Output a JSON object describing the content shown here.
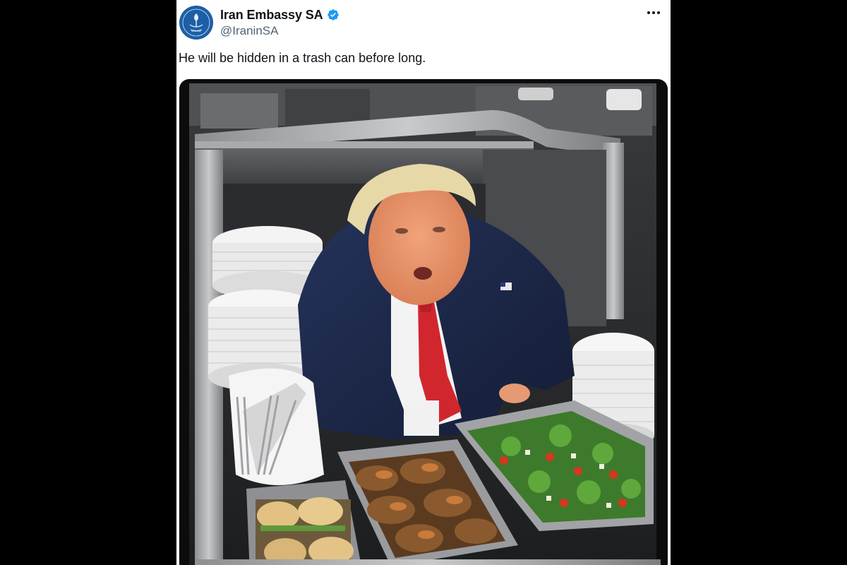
{
  "tweet": {
    "author": {
      "display_name": "Iran Embassy SA",
      "handle": "@IraninSA",
      "verified": true,
      "avatar_icon": "embassy-emblem-icon"
    },
    "more_icon": "more-options-icon",
    "text": "He will be hidden in a trash can before long.",
    "media": {
      "type": "image",
      "alt": ""
    }
  },
  "colors": {
    "verified_blue": "#1d9bf0",
    "avatar_blue": "#1d5fa6",
    "name_text": "#0f1419",
    "handle_text": "#536471",
    "page_background": "#000000"
  }
}
